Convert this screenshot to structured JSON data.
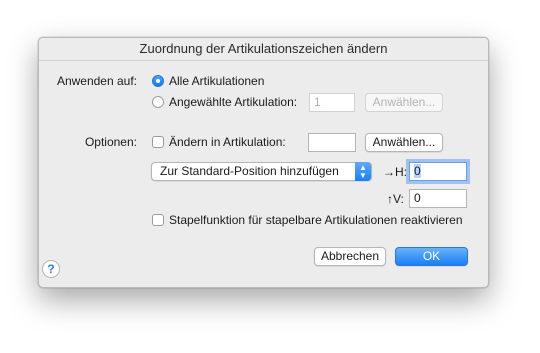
{
  "dialog": {
    "title": "Zuordnung der Artikulationszeichen ändern"
  },
  "apply": {
    "label": "Anwenden auf:",
    "option_all": "Alle Artikulationen",
    "option_selected": "Angewählte Artikulation:",
    "selected_value": "1",
    "choose_button": "Anwählen..."
  },
  "options": {
    "label": "Optionen:",
    "change_label": "Ändern in Artikulation:",
    "change_value": "",
    "choose_button": "Anwählen...",
    "position_select": "Zur Standard-Position hinzufügen",
    "h_label": "→H:",
    "h_value": "0",
    "v_label": "↑V:",
    "v_value": "0",
    "stack_label": "Stapelfunktion für stapelbare Artikulationen reaktivieren"
  },
  "footer": {
    "help": "?",
    "cancel": "Abbrechen",
    "ok": "OK"
  },
  "colors": {
    "accent": "#1b7ff5",
    "dialog_bg": "#ececec"
  }
}
